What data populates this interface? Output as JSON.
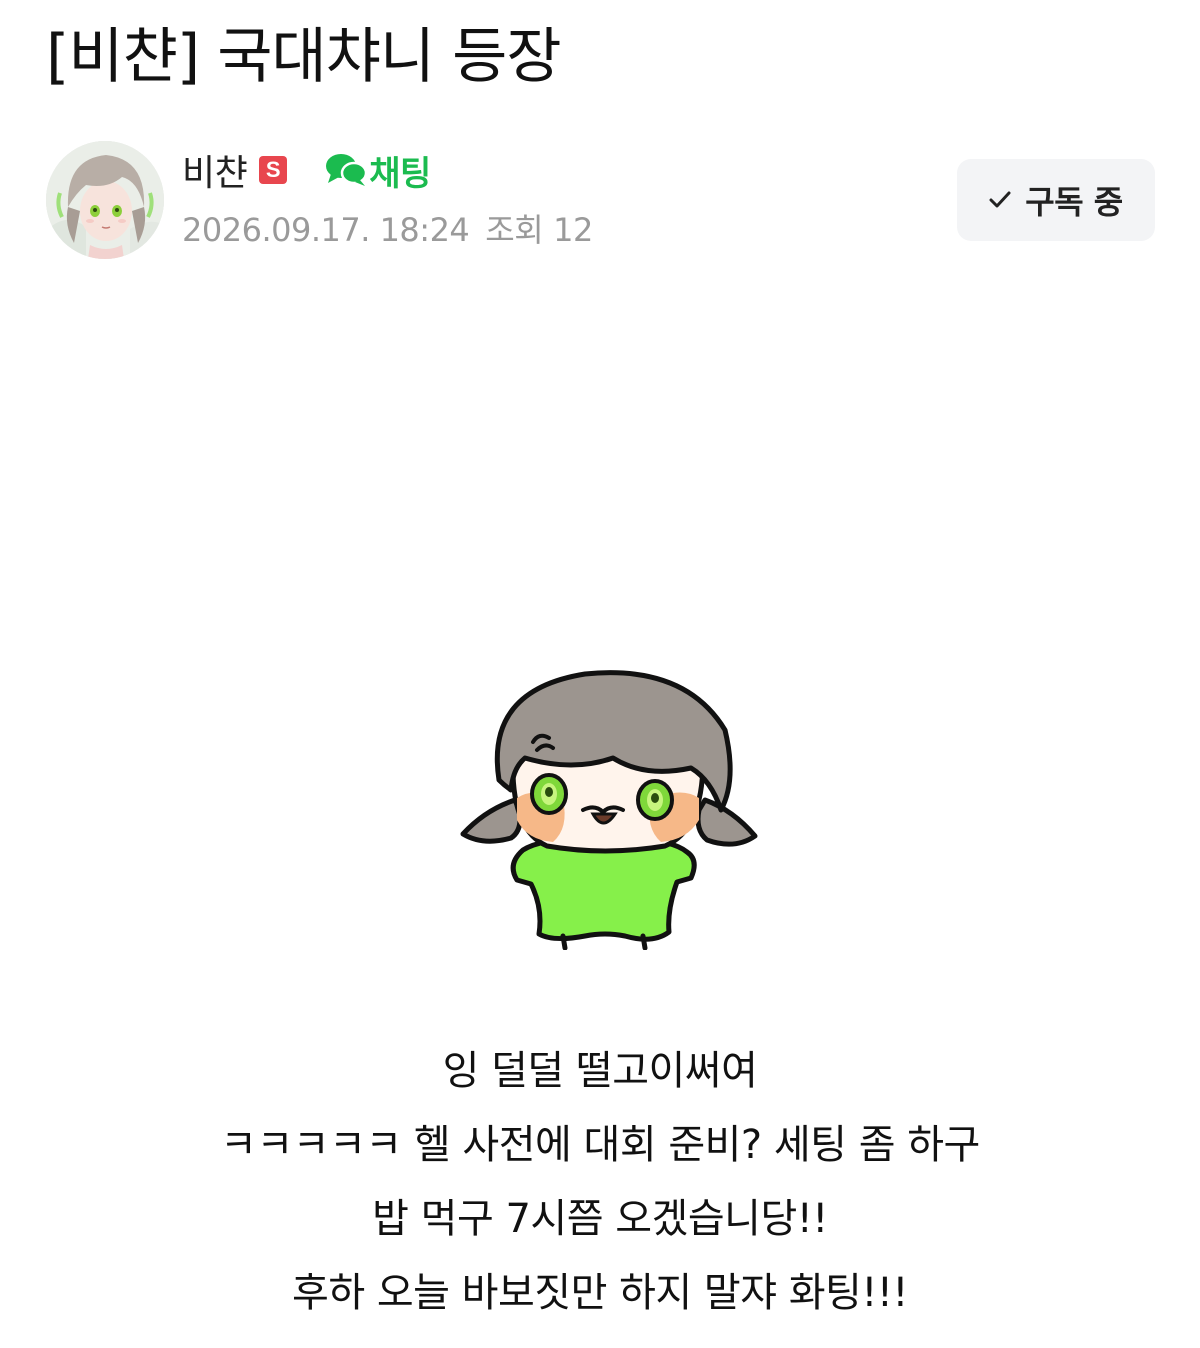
{
  "post": {
    "title": "[비챤] 국대챠니 등장",
    "author": {
      "name": "비챤",
      "badge": "S",
      "badge_color": "#e8464e"
    },
    "chat": {
      "label": "채팅",
      "icon": "chat-bubbles-icon",
      "color": "#1bbb4f"
    },
    "date": "2026.09.17. 18:24",
    "views_label": "조회",
    "views_count": "12",
    "subscribe": {
      "label": "구독 중",
      "icon": "check-icon"
    },
    "body_lines": [
      "잉 덜덜 떨고이써여",
      "ㅋㅋㅋㅋㅋ 헬 사전에 대회 준비? 세팅 좀 하구",
      "밥 먹구 7시쯤 오겠습니당!!",
      "후하 오늘 바보짓만 하지 말쟈 화팅!!!"
    ]
  }
}
